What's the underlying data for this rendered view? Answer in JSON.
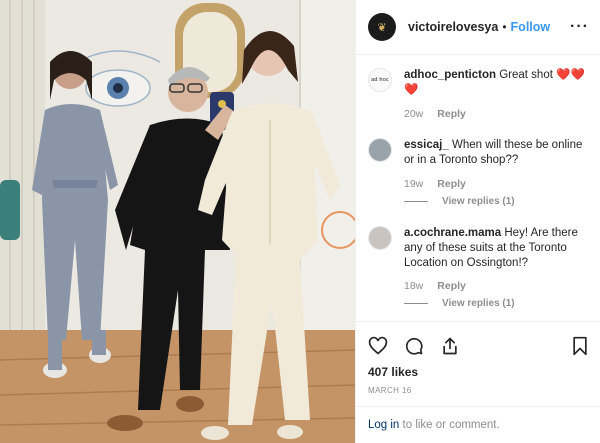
{
  "header": {
    "username": "victoirelovesya",
    "separator": "•",
    "follow_label": "Follow",
    "more_icon": "more-horizontal-icon"
  },
  "comments": [
    {
      "username": "adhoc_penticton",
      "avatar_text": "ad hoc",
      "text": "Great shot",
      "emoji": "❤️❤️❤️",
      "age": "20w",
      "reply_label": "Reply"
    },
    {
      "username": "essicaj_",
      "text": "When will these be online or in a Toronto shop??",
      "age": "19w",
      "reply_label": "Reply",
      "view_replies": "View replies (1)"
    },
    {
      "username": "a.cochrane.mama",
      "text": "Hey! Are there any of these suits at the Toronto Location on Ossington!?",
      "age": "18w",
      "reply_label": "Reply",
      "view_replies": "View replies (1)"
    }
  ],
  "actions": {
    "icons": [
      "heart-icon",
      "comment-icon",
      "share-icon",
      "bookmark-icon"
    ],
    "likes": "407 likes",
    "date": "MARCH 16"
  },
  "footer": {
    "login_link": "Log in",
    "login_suffix": " to like or comment."
  },
  "colors": {
    "accent": "#3897f0",
    "text": "#262626",
    "muted": "#8e8e8e",
    "link": "#003569"
  }
}
